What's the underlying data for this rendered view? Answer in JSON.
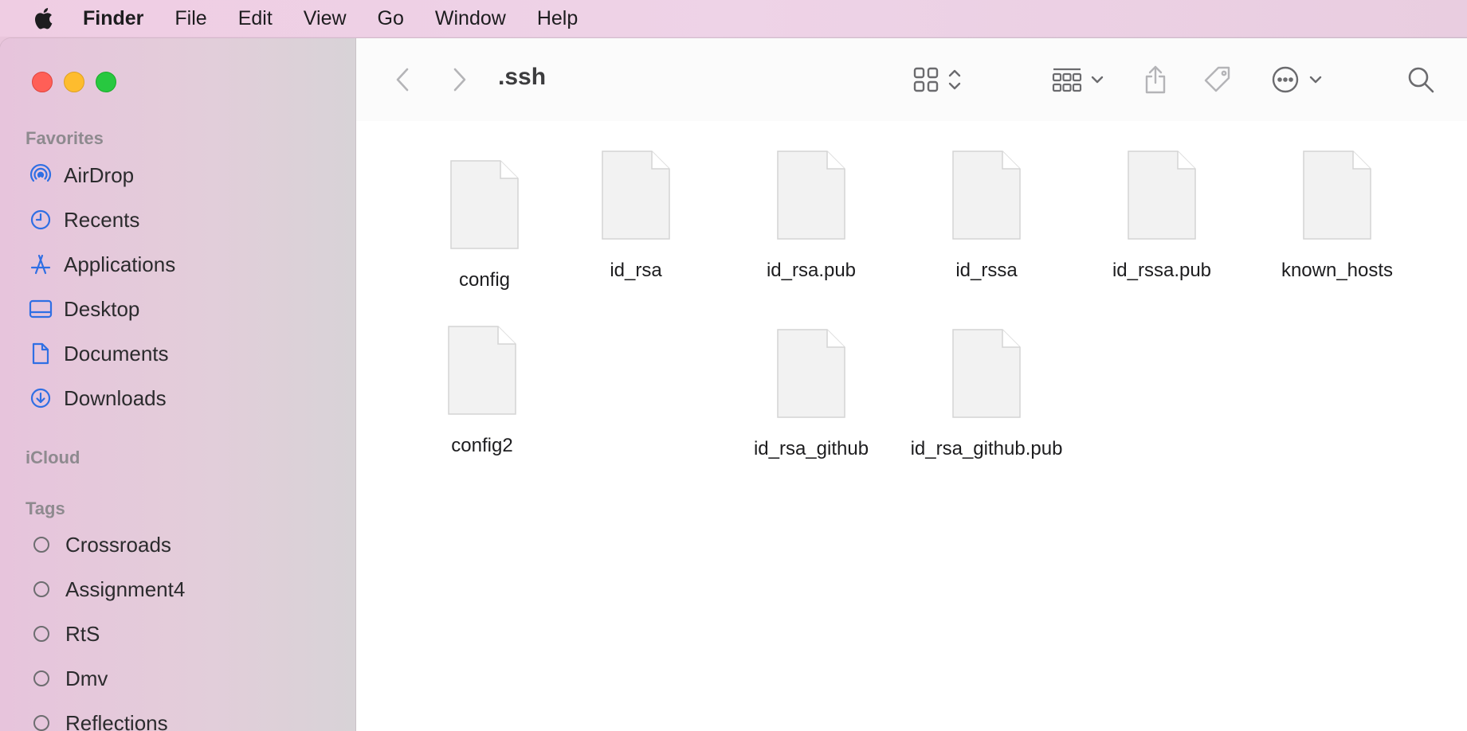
{
  "menubar": {
    "app_name": "Finder",
    "items": [
      "File",
      "Edit",
      "View",
      "Go",
      "Window",
      "Help"
    ]
  },
  "sidebar": {
    "favorites_title": "Favorites",
    "favorites": [
      {
        "label": "AirDrop",
        "icon": "airdrop-icon"
      },
      {
        "label": "Recents",
        "icon": "clock-icon"
      },
      {
        "label": "Applications",
        "icon": "applications-icon"
      },
      {
        "label": "Desktop",
        "icon": "desktop-icon"
      },
      {
        "label": "Documents",
        "icon": "document-icon"
      },
      {
        "label": "Downloads",
        "icon": "download-icon"
      }
    ],
    "icloud_title": "iCloud",
    "tags_title": "Tags",
    "tags": [
      "Crossroads",
      "Assignment4",
      "RtS",
      "Dmv",
      "Reflections"
    ]
  },
  "toolbar": {
    "folder_title": ".ssh"
  },
  "files": [
    {
      "name": "config"
    },
    {
      "name": "id_rsa"
    },
    {
      "name": "id_rsa.pub"
    },
    {
      "name": "id_rssa"
    },
    {
      "name": "id_rssa.pub"
    },
    {
      "name": "known_hosts"
    },
    {
      "name": "config2"
    },
    {
      "name": "id_rsa_github"
    },
    {
      "name": "id_rsa_github.pub"
    }
  ],
  "colors": {
    "accent": "#2f6fe4",
    "traffic_red": "#ff5f57",
    "traffic_yellow": "#febc2e",
    "traffic_green": "#28c840"
  }
}
